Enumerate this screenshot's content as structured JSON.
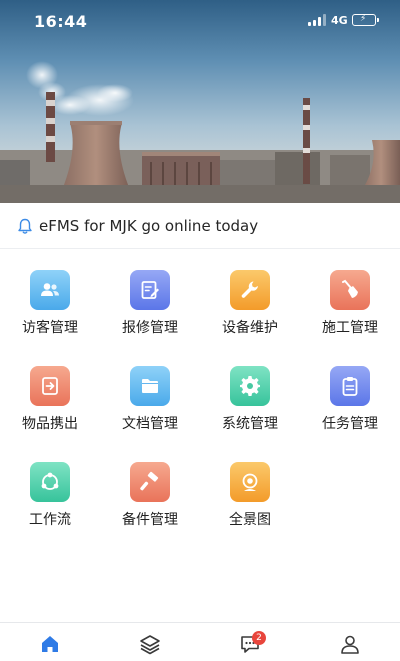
{
  "status_bar": {
    "time": "16:44",
    "network": "4G",
    "battery_level": 1.0
  },
  "banner": {
    "image": "industrial-plant-cooling-tower"
  },
  "notice": {
    "icon": "bell-icon",
    "text": "eFMS for MJK go online today"
  },
  "menu": [
    {
      "label": "访客管理",
      "icon": "visitors-icon",
      "color_from": "#8fd2f8",
      "color_to": "#4aa9ea"
    },
    {
      "label": "报修管理",
      "icon": "repair-form-icon",
      "color_from": "#96a8f5",
      "color_to": "#5b76e8"
    },
    {
      "label": "设备维护",
      "icon": "wrench-icon",
      "color_from": "#fbc96b",
      "color_to": "#f39b2a"
    },
    {
      "label": "施工管理",
      "icon": "shovel-icon",
      "color_from": "#f6a98f",
      "color_to": "#e9735a"
    },
    {
      "label": "物品携出",
      "icon": "exit-arrow-icon",
      "color_from": "#f6a98f",
      "color_to": "#e9735a"
    },
    {
      "label": "文档管理",
      "icon": "folder-icon",
      "color_from": "#8fd2f8",
      "color_to": "#4aa9ea"
    },
    {
      "label": "系统管理",
      "icon": "gear-icon",
      "color_from": "#7fe3c4",
      "color_to": "#37c39b"
    },
    {
      "label": "任务管理",
      "icon": "clipboard-icon",
      "color_from": "#96a8f5",
      "color_to": "#5b76e8"
    },
    {
      "label": "工作流",
      "icon": "workflow-icon",
      "color_from": "#7fe3c4",
      "color_to": "#37c39b"
    },
    {
      "label": "备件管理",
      "icon": "hammer-icon",
      "color_from": "#f6a98f",
      "color_to": "#e9735a"
    },
    {
      "label": "全景图",
      "icon": "panorama-camera-icon",
      "color_from": "#fbc96b",
      "color_to": "#f39b2a"
    }
  ],
  "tabbar": {
    "tabs": [
      {
        "icon": "home-icon",
        "active": true
      },
      {
        "icon": "layers-icon",
        "active": false
      },
      {
        "icon": "message-icon",
        "active": false,
        "badge": "2"
      },
      {
        "icon": "user-icon",
        "active": false
      }
    ],
    "active_color": "#2f7be6",
    "inactive_color": "#3a3a3a"
  }
}
